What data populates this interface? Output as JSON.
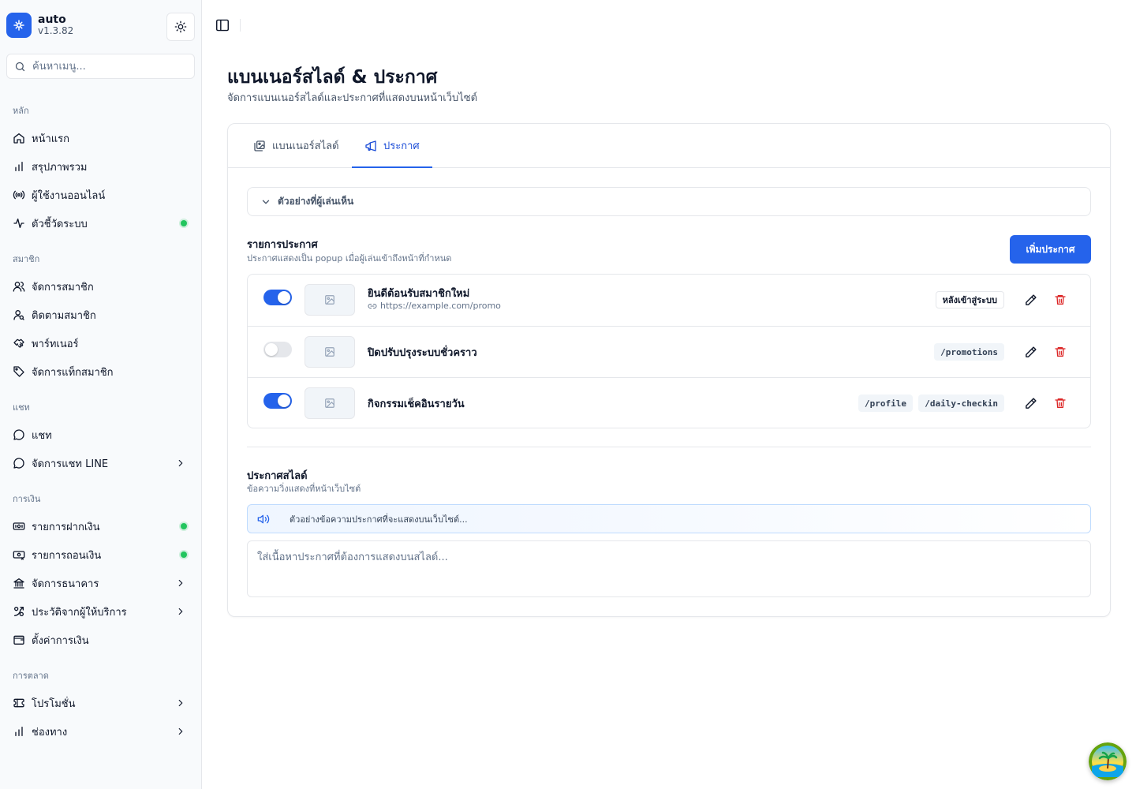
{
  "app": {
    "name": "auto",
    "version": "v1.3.82"
  },
  "search": {
    "placeholder": "ค้นหาเมนู..."
  },
  "sidebar": {
    "groups": [
      {
        "label": "หลัก",
        "items": [
          {
            "label": "หน้าแรก",
            "icon": "home-icon"
          },
          {
            "label": "สรุปภาพรวม",
            "icon": "bar-chart-icon"
          },
          {
            "label": "ผู้ใช้งานออนไลน์",
            "icon": "radio-icon"
          },
          {
            "label": "ตัวชี้วัดระบบ",
            "icon": "activity-icon",
            "status_dot": true
          }
        ]
      },
      {
        "label": "สมาชิก",
        "items": [
          {
            "label": "จัดการสมาชิก",
            "icon": "users-icon"
          },
          {
            "label": "ติดตามสมาชิก",
            "icon": "user-search-icon"
          },
          {
            "label": "พาร์ทเนอร์",
            "icon": "handshake-icon"
          },
          {
            "label": "จัดการแท็กสมาชิก",
            "icon": "tag-icon"
          }
        ]
      },
      {
        "label": "แชท",
        "items": [
          {
            "label": "แชท",
            "icon": "chat-icon"
          },
          {
            "label": "จัดการแชท LINE",
            "icon": "chat-icon",
            "has_submenu": true
          }
        ]
      },
      {
        "label": "การเงิน",
        "items": [
          {
            "label": "รายการฝากเงิน",
            "icon": "deposit-icon",
            "status_dot": true
          },
          {
            "label": "รายการถอนเงิน",
            "icon": "withdraw-icon",
            "status_dot": true
          },
          {
            "label": "จัดการธนาคาร",
            "icon": "bank-icon",
            "has_submenu": true
          },
          {
            "label": "ประวัติจากผู้ให้บริการ",
            "icon": "history-icon",
            "has_submenu": true
          },
          {
            "label": "ตั้งค่าการเงิน",
            "icon": "wallet-icon"
          }
        ]
      },
      {
        "label": "การตลาด",
        "items": [
          {
            "label": "โปรโมชั่น",
            "icon": "ticket-icon",
            "has_submenu": true
          },
          {
            "label": "ช่องทาง",
            "icon": "bar-chart-icon",
            "has_submenu": true
          }
        ]
      }
    ]
  },
  "page": {
    "title": "แบนเนอร์สไลด์ & ประกาศ",
    "subtitle": "จัดการแบนเนอร์สไลด์และประกาศที่แสดงบนหน้าเว็บไซต์"
  },
  "tabs": [
    {
      "label": "แบนเนอร์สไลด์",
      "icon": "images-icon",
      "active": false
    },
    {
      "label": "ประกาศ",
      "icon": "megaphone-icon",
      "active": true
    }
  ],
  "preview": {
    "label": "ตัวอย่างที่ผู้เล่นเห็น",
    "expanded": false
  },
  "announcements": {
    "title": "รายการประกาศ",
    "description": "ประกาศแสดงเป็น popup เมื่อผู้เล่นเข้าถึงหน้าที่กำหนด",
    "add_label": "เพิ่มประกาศ",
    "items": [
      {
        "title": "ยินดีต้อนรับสมาชิกใหม่",
        "link": "https://example.com/promo",
        "enabled": true,
        "tags": [
          "หลังเข้าสู่ระบบ"
        ],
        "tag_style": "outline"
      },
      {
        "title": "ปิดปรับปรุงระบบชั่วคราว",
        "link": "",
        "enabled": false,
        "tags": [
          "/promotions"
        ],
        "tag_style": "mono"
      },
      {
        "title": "กิจกรรมเช็คอินรายวัน",
        "link": "",
        "enabled": true,
        "tags": [
          "/profile",
          "/daily-checkin"
        ],
        "tag_style": "mono"
      }
    ]
  },
  "marquee": {
    "title": "ประกาศสไลด์",
    "description": "ข้อความวิ่งแสดงที่หน้าเว็บไซต์",
    "preview_text": "ตัวอย่างข้อความประกาศที่จะแสดงบนเว็บไซต์...",
    "input_value": "",
    "input_placeholder": "ใส่เนื้อหาประกาศที่ต้องการแสดงบนสไลด์..."
  },
  "colors": {
    "accent": "#2563eb",
    "danger": "#dc2626",
    "online": "#22c55e"
  }
}
